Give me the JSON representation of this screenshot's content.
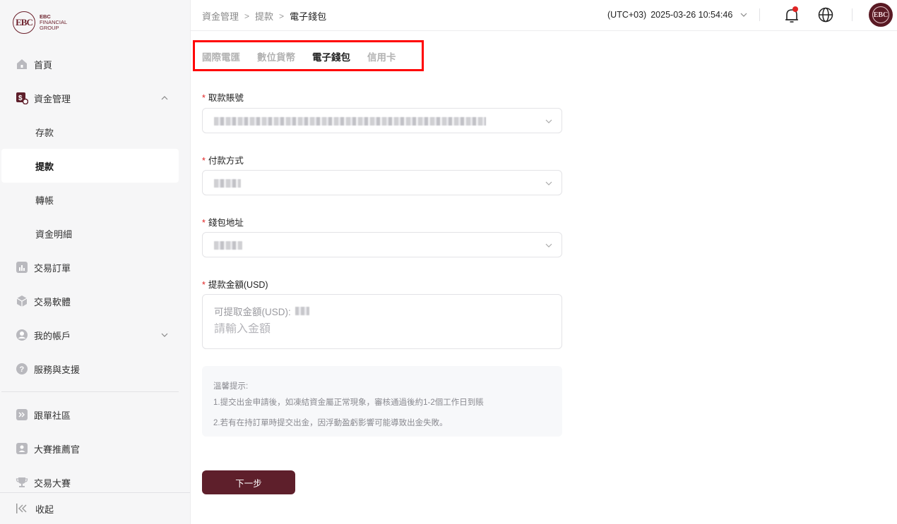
{
  "brand": {
    "logo_mark": "EBC",
    "line1": "EBC",
    "line2": "FINANCIAL",
    "line3": "GROUP",
    "accent_color": "#5e1f2b"
  },
  "sidebar": {
    "items": [
      {
        "label": "首頁",
        "icon": "home-icon"
      },
      {
        "label": "資金管理",
        "icon": "fund-icon",
        "expanded": true
      },
      {
        "label": "存款",
        "sub": true
      },
      {
        "label": "提款",
        "sub": true,
        "active": true
      },
      {
        "label": "轉帳",
        "sub": true
      },
      {
        "label": "資金明細",
        "sub": true
      },
      {
        "label": "交易訂單",
        "icon": "chart-icon"
      },
      {
        "label": "交易軟體",
        "icon": "cube-icon"
      },
      {
        "label": "我的帳戶",
        "icon": "user-icon",
        "expandable": true
      },
      {
        "label": "服務與支援",
        "icon": "help-icon"
      },
      {
        "label": "跟單社區",
        "icon": "copy-trade-icon"
      },
      {
        "label": "大賽推薦官",
        "icon": "referral-icon"
      },
      {
        "label": "交易大賽",
        "icon": "trophy-icon"
      }
    ],
    "collapse_label": "收起"
  },
  "header": {
    "breadcrumb": [
      "資金管理",
      "提款",
      "電子錢包"
    ],
    "breadcrumb_sep": ">",
    "timezone": "(UTC+03)",
    "datetime": "2025-03-26 10:54:46"
  },
  "tabs": [
    "國際電匯",
    "數位貨幣",
    "電子錢包",
    "信用卡"
  ],
  "active_tab": 2,
  "form": {
    "account_label": "取款賬號",
    "payment_label": "付款方式",
    "wallet_label": "錢包地址",
    "amount_label": "提款金額(USD)",
    "available_label": "可提取金額(USD):",
    "amount_placeholder": "請輸入金額",
    "required_mark": "*"
  },
  "notice": {
    "title": "溫馨提示:",
    "line1": "1.提交出金申請後，如凍結資金屬正常現象，審核通過後約1-2個工作日到賬",
    "line2": "2.若有在持訂單時提交出金，因浮動盈虧影響可能導致出金失敗。"
  },
  "next_button": "下一步"
}
